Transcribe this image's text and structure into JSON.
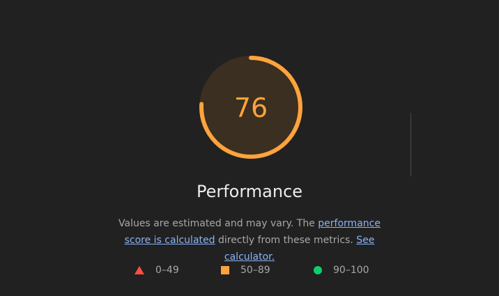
{
  "gauge": {
    "score": "76",
    "score_fraction": 0.76,
    "title": "Performance",
    "color": "#ffa33d",
    "track_color": "#3a2f20"
  },
  "description": {
    "text_before": "Values are estimated and may vary. The ",
    "link1": "performance score is calculated",
    "text_middle": " directly from these metrics. ",
    "link2": "See calculator."
  },
  "legend": [
    {
      "icon": "triangle-icon",
      "label": "0–49",
      "color": "#ff4e42"
    },
    {
      "icon": "square-icon",
      "label": "50–89",
      "color": "#ffa33d"
    },
    {
      "icon": "circle-icon",
      "label": "90–100",
      "color": "#0cce6b"
    }
  ]
}
